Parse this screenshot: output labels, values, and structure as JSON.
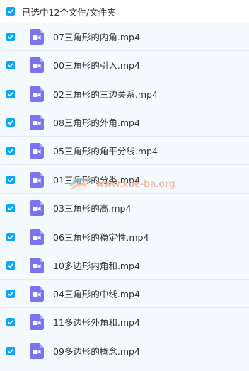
{
  "header": {
    "selected_text": "已选中12个文件/文件夹",
    "checked": true
  },
  "files": [
    {
      "name": "07三角形的内角.mp4",
      "checked": true,
      "icon": "video-file-icon"
    },
    {
      "name": "00三角形的引入.mp4",
      "checked": true,
      "icon": "video-file-icon"
    },
    {
      "name": "02三角形的三边关系.mp4",
      "checked": true,
      "icon": "video-file-icon"
    },
    {
      "name": "08三角形的外角.mp4",
      "checked": true,
      "icon": "video-file-icon"
    },
    {
      "name": "05三角形的角平分线.mp4",
      "checked": true,
      "icon": "video-file-icon"
    },
    {
      "name": "01三角形的分类.mp4",
      "checked": true,
      "icon": "video-file-icon"
    },
    {
      "name": "03三角形的高.mp4",
      "checked": true,
      "icon": "video-file-icon"
    },
    {
      "name": "06三角形的稳定性.mp4",
      "checked": true,
      "icon": "video-file-icon"
    },
    {
      "name": "10多边形内角和.mp4",
      "checked": true,
      "icon": "video-file-icon"
    },
    {
      "name": "04三角形的中线.mp4",
      "checked": true,
      "icon": "video-file-icon"
    },
    {
      "name": "11多边形外角和.mp4",
      "checked": true,
      "icon": "video-file-icon"
    },
    {
      "name": "09多边形的概念.mp4",
      "checked": true,
      "icon": "video-file-icon"
    }
  ],
  "watermark": {
    "text": "www.xue-ba.org"
  },
  "colors": {
    "checkbox": "#06a7ff",
    "video_icon": "#7b74f0",
    "list_background": "#f4fbfe",
    "watermark_text": "#f4a58a"
  }
}
